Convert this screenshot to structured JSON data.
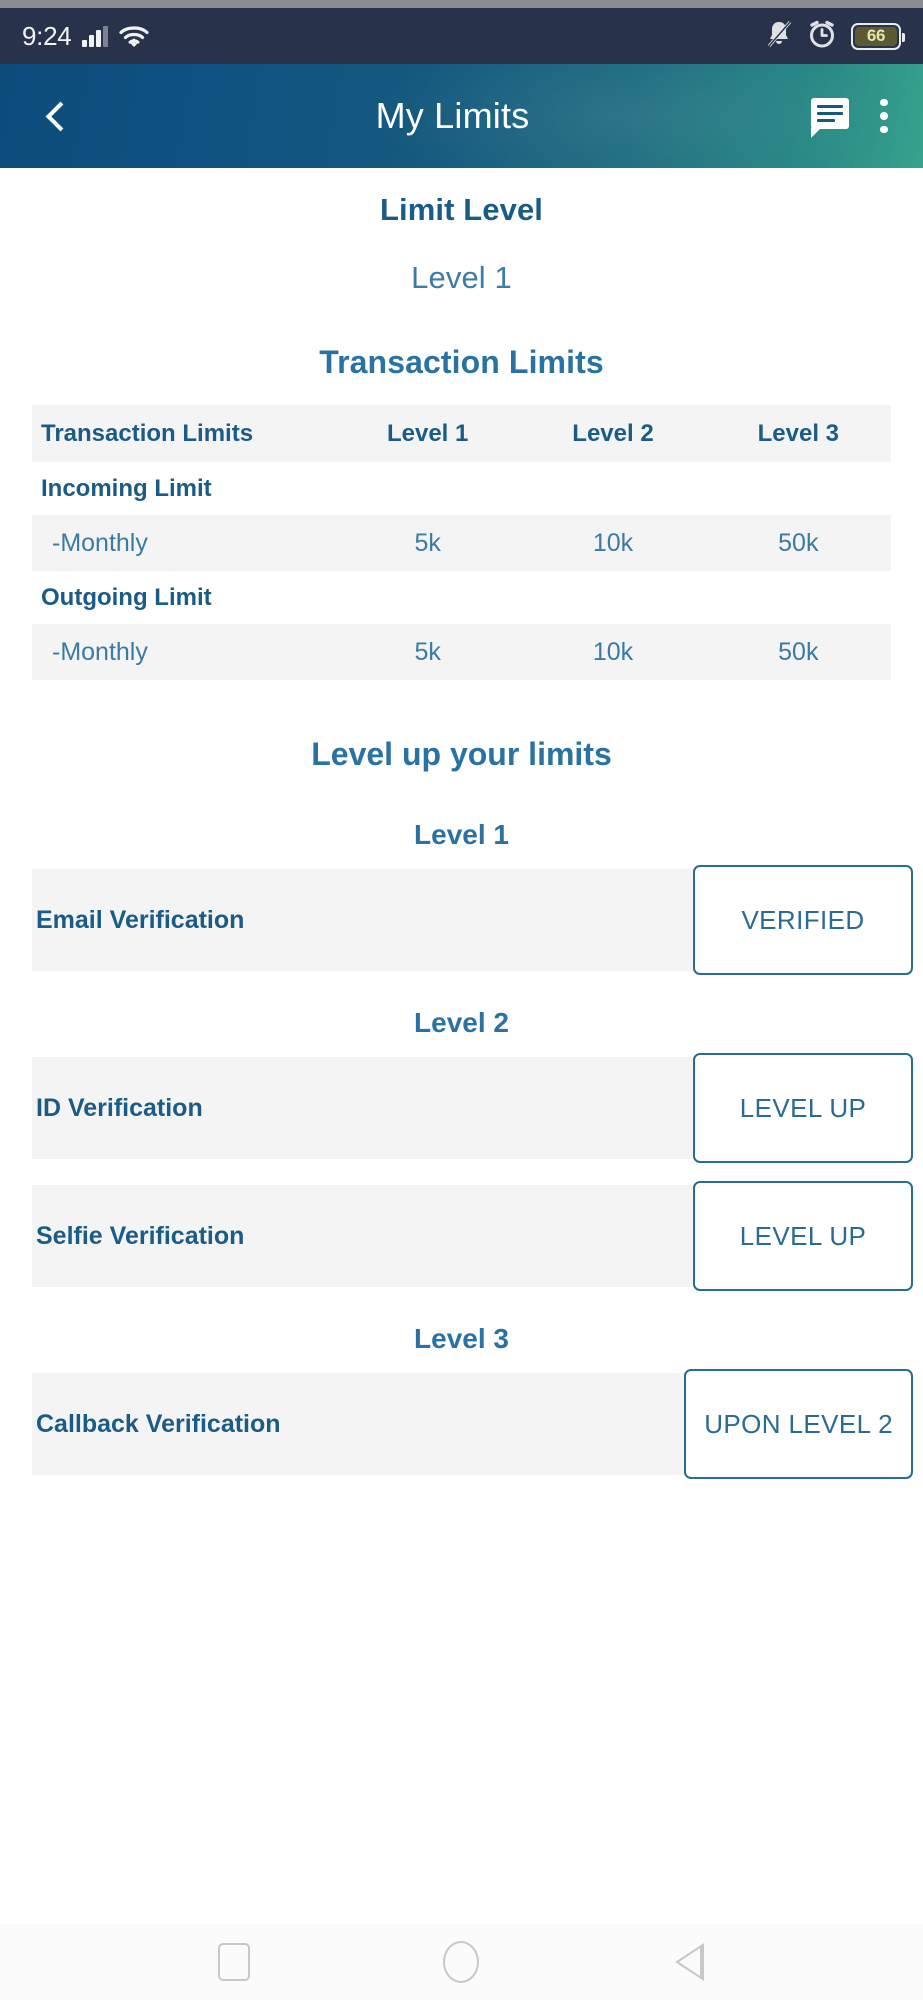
{
  "status_bar": {
    "time": "9:24",
    "battery_level": "66",
    "icons": [
      "signal-bars-icon",
      "wifi-icon",
      "mute-bell-icon",
      "alarm-clock-icon",
      "battery-icon"
    ]
  },
  "header": {
    "title": "My Limits",
    "back_icon": "chevron-left-icon",
    "chat_icon": "chat-bubble-icon",
    "overflow_icon": "kebab-menu-icon",
    "gradient_from": "#0c4c7d",
    "gradient_to": "#37a28d"
  },
  "limit_level": {
    "heading": "Limit Level",
    "value": "Level 1"
  },
  "transaction_limits": {
    "heading": "Transaction Limits",
    "columns": [
      "Transaction Limits",
      "Level 1",
      "Level 2",
      "Level 3"
    ],
    "groups": [
      {
        "label": "Incoming Limit",
        "rows": [
          {
            "label": "-Monthly",
            "level1": "5k",
            "level2": "10k",
            "level3": "50k"
          }
        ]
      },
      {
        "label": "Outgoing Limit",
        "rows": [
          {
            "label": "-Monthly",
            "level1": "5k",
            "level2": "10k",
            "level3": "50k"
          }
        ]
      }
    ]
  },
  "level_up": {
    "heading": "Level up your limits",
    "sections": [
      {
        "title": "Level 1",
        "items": [
          {
            "label": "Email Verification",
            "action": "VERIFIED"
          }
        ]
      },
      {
        "title": "Level 2",
        "items": [
          {
            "label": "ID Verification",
            "action": "LEVEL UP"
          },
          {
            "label": "Selfie Verification",
            "action": "LEVEL UP"
          }
        ]
      },
      {
        "title": "Level 3",
        "items": [
          {
            "label": "Callback Verification",
            "action": "UPON LEVEL 2"
          }
        ]
      }
    ]
  },
  "nav_bar": {
    "recents_icon": "square-recents-icon",
    "home_icon": "circle-home-icon",
    "back_icon": "triangle-back-icon"
  },
  "colors": {
    "primary_blue": "#1b5c86",
    "accent_blue": "#2a72a3",
    "row_gray": "#f4f4f4",
    "status_bg": "#28324a"
  }
}
